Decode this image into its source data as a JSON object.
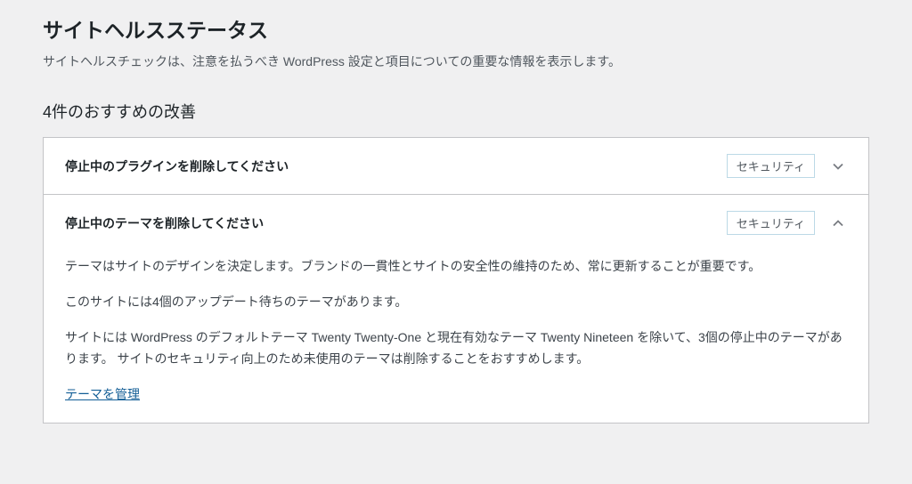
{
  "page": {
    "title": "サイトヘルスステータス",
    "description": "サイトヘルスチェックは、注意を払うべき WordPress 設定と項目についての重要な情報を表示します。"
  },
  "improvements": {
    "heading": "4件のおすすめの改善",
    "items": [
      {
        "title": "停止中のプラグインを削除してください",
        "badge": "セキュリティ",
        "expanded": false
      },
      {
        "title": "停止中のテーマを削除してください",
        "badge": "セキュリティ",
        "expanded": true,
        "body": {
          "p1": "テーマはサイトのデザインを決定します。ブランドの一貫性とサイトの安全性の維持のため、常に更新することが重要です。",
          "p2": "このサイトには4個のアップデート待ちのテーマがあります。",
          "p3": "サイトには WordPress のデフォルトテーマ Twenty Twenty-One と現在有効なテーマ Twenty Nineteen を除いて、3個の停止中のテーマがあります。 サイトのセキュリティ向上のため未使用のテーマは削除することをおすすめします。",
          "link_text": "テーマを管理"
        }
      }
    ]
  }
}
